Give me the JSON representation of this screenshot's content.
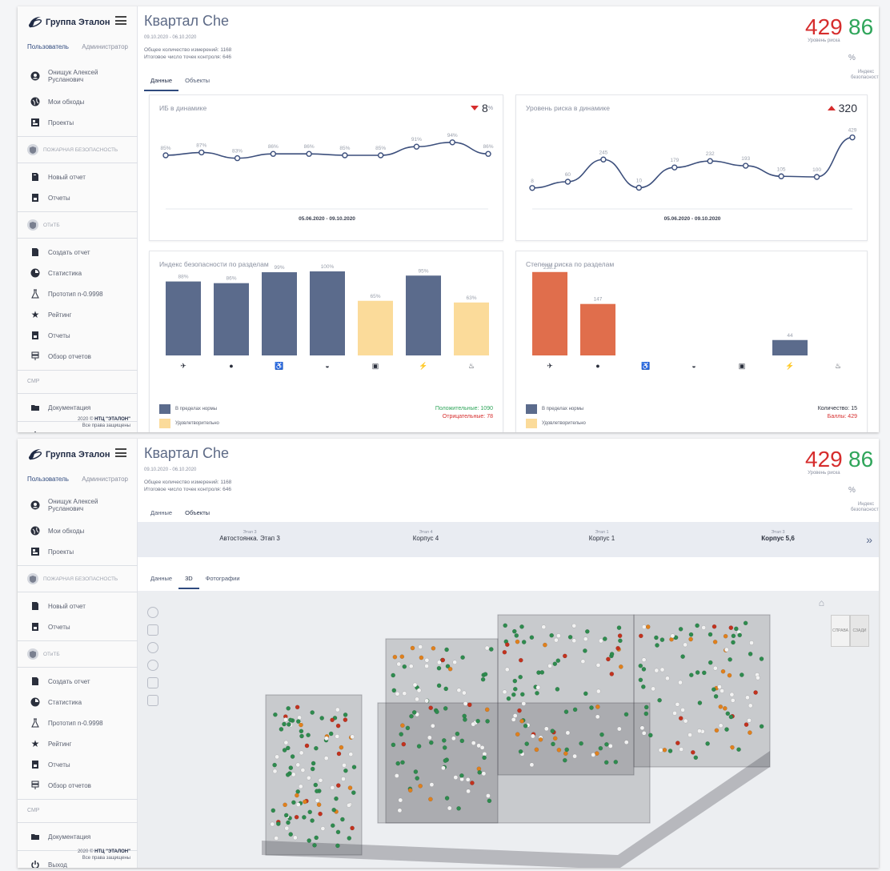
{
  "app": {
    "logo_text": "Группа Эталон"
  },
  "sidebar": {
    "roles": [
      "Пользователь",
      "Администратор"
    ],
    "user": "Онищук Алексей Русланович",
    "items_top": [
      {
        "label": "Мои обходы",
        "icon": "globe-icon"
      },
      {
        "label": "Проекты",
        "icon": "projects-icon"
      }
    ],
    "section_fire": "ПОЖАРНАЯ БЕЗОПАСНОСТЬ",
    "fire_items": [
      {
        "label": "Новый отчет",
        "icon": "document-icon"
      },
      {
        "label": "Отчеты",
        "icon": "reports-icon"
      }
    ],
    "section_ot": "ОТиТБ",
    "ot_items": [
      {
        "label": "Создать отчет",
        "icon": "document-icon"
      },
      {
        "label": "Статистика",
        "icon": "pie-icon"
      },
      {
        "label": "Прототип n-0.9998",
        "icon": "flask-icon"
      },
      {
        "label": "Рейтинг",
        "icon": "star-icon"
      },
      {
        "label": "Отчеты",
        "icon": "reports-icon"
      },
      {
        "label": "Обзор отчетов",
        "icon": "list-icon"
      }
    ],
    "section_smr": "СМР",
    "docs": "Документация",
    "exit": "Выход",
    "copyright_1": "2020 ©",
    "copyright_brand": "НТЦ \"ЭТАЛОН\"",
    "copyright_2": "Все права защищены"
  },
  "header": {
    "title": "Квартал Che",
    "dates_1": "09.10.2020 - 06.10.2020",
    "dates_2": "09.10.2020 - 06.10.2020",
    "measurements": "Общее количество измерений: 1168",
    "points": "Итоговое число точек контроля: 646",
    "risk_value": "429",
    "risk_label": "Уровень риска",
    "safety_value": "86",
    "safety_unit": "%",
    "safety_label": "Индекс безопасности",
    "colors": {
      "risk": "#d62d2d",
      "safety": "#2fa55a"
    }
  },
  "tabs": [
    "Данные",
    "Объекты"
  ],
  "charts": {
    "ib": {
      "title": "ИБ в динамике",
      "delta": "8",
      "delta_unit": "%",
      "date_range": "05.06.2020 - 09.10.2020"
    },
    "risk": {
      "title": "Уровень риска в динамике",
      "delta": "320",
      "date_range": "05.06.2020 - 09.10.2020"
    },
    "ib_sections": {
      "title": "Индекс безопасности по разделам",
      "positive": "Положительные: 1090",
      "negative": "Отрицательные: 78"
    },
    "risk_sections": {
      "title": "Степени риска по разделам",
      "count": "Количество: 15",
      "score": "Баллы: 429"
    },
    "legend": [
      "В пределах нормы",
      "Удовлетворительно"
    ],
    "section_icons": [
      "crane-icon",
      "worker-icon",
      "ladder-icon",
      "helmet-icon",
      "scaffold-icon",
      "lightning-icon",
      "fire-icon"
    ]
  },
  "chart_data": [
    {
      "type": "line",
      "title": "ИБ в динамике",
      "x": [
        "1",
        "2",
        "3",
        "4",
        "5",
        "6",
        "7",
        "8",
        "9",
        "10"
      ],
      "values": [
        85,
        87,
        83,
        86,
        86,
        85,
        85,
        91,
        94,
        86
      ],
      "labels": [
        "85%",
        "87%",
        "83%",
        "86%",
        "86%",
        "85%",
        "85%",
        "91%",
        "94%",
        "86%"
      ],
      "xlabel": "05.06.2020 - 09.10.2020",
      "color": "#3c4f7c"
    },
    {
      "type": "line",
      "title": "Уровень риска в динамике",
      "x": [
        "1",
        "2",
        "3",
        "4",
        "5",
        "6",
        "7",
        "8",
        "9",
        "10"
      ],
      "values": [
        8,
        60,
        245,
        10,
        179,
        232,
        193,
        105,
        100,
        429
      ],
      "labels": [
        "8",
        "60",
        "245",
        "10",
        "179",
        "232",
        "193",
        "105",
        "100",
        "429"
      ],
      "xlabel": "05.06.2020 - 09.10.2020",
      "color": "#3c4f7c"
    },
    {
      "type": "bar",
      "title": "Индекс безопасности по разделам",
      "values": [
        88,
        86,
        99,
        100,
        65,
        95,
        63
      ],
      "labels": [
        "88%",
        "86%",
        "99%",
        "100%",
        "65%",
        "95%",
        "63%"
      ],
      "colors": [
        "#5b6b8c",
        "#5b6b8c",
        "#5b6b8c",
        "#5b6b8c",
        "#fbdb9a",
        "#5b6b8c",
        "#fbdb9a"
      ],
      "ylim": [
        0,
        100
      ]
    },
    {
      "type": "bar",
      "title": "Степени риска по разделам",
      "values": [
        238.2,
        147,
        0,
        0,
        0,
        44,
        0
      ],
      "labels": [
        "238.2",
        "147",
        "",
        "",
        "",
        "44",
        ""
      ],
      "colors": [
        "#e06e4c",
        "#e06e4c",
        "#e06e4c",
        "#e06e4c",
        "#e06e4c",
        "#5b6b8c",
        "#e06e4c"
      ],
      "ylim": [
        0,
        240
      ]
    }
  ],
  "objects": {
    "items": [
      {
        "stage": "Этап 3",
        "name": "Автостоянка. Этап 3"
      },
      {
        "stage": "Этап 4",
        "name": "Корпус 4"
      },
      {
        "stage": "Этап 1",
        "name": "Корпус 1"
      },
      {
        "stage": "Этап 3",
        "name": "Корпус 5,6"
      }
    ],
    "subtabs": [
      "Данные",
      "3D",
      "Фотографии"
    ],
    "cube_labels": [
      "СПРАВА",
      "СЗАДИ"
    ]
  }
}
